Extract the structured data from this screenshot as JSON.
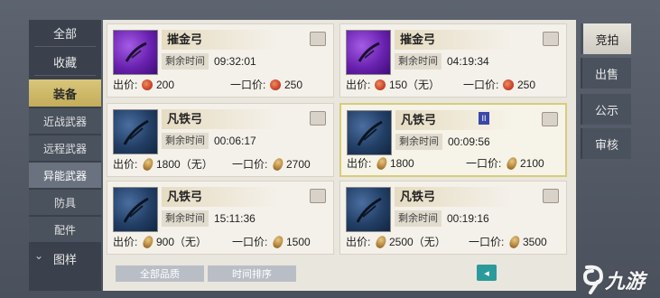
{
  "sidebar": {
    "items": [
      {
        "label": "全部"
      },
      {
        "label": "收藏"
      },
      {
        "label": "装备",
        "active": true
      },
      {
        "label": "近战武器"
      },
      {
        "label": "远程武器"
      },
      {
        "label": "异能武器",
        "selected": true
      },
      {
        "label": "防具"
      },
      {
        "label": "配件"
      },
      {
        "label": "图样"
      }
    ],
    "collapse_glyph": "⌄"
  },
  "listings": [
    {
      "name": "摧金弓",
      "time_label": "剩余时间",
      "time": "09:32:01",
      "bid_label": "出价:",
      "bid": "200",
      "buyout_label": "一口价:",
      "buyout": "250",
      "currency": "red-coin",
      "thumb": "purple"
    },
    {
      "name": "摧金弓",
      "time_label": "剩余时间",
      "time": "04:19:34",
      "bid_label": "出价:",
      "bid": "150（无）",
      "buyout_label": "一口价:",
      "buyout": "250",
      "currency": "red-coin",
      "thumb": "purple"
    },
    {
      "name": "凡铁弓",
      "time_label": "剩余时间",
      "time": "00:06:17",
      "bid_label": "出价:",
      "bid": "1800（无）",
      "buyout_label": "一口价:",
      "buyout": "2700",
      "currency": "gold-coin",
      "thumb": "blue"
    },
    {
      "name": "凡铁弓",
      "time_label": "剩余时间",
      "time": "00:09:56",
      "bid_label": "出价:",
      "bid": "1800",
      "buyout_label": "一口价:",
      "buyout": "2100",
      "currency": "gold-coin",
      "thumb": "blue",
      "badge": "II",
      "selected": true
    },
    {
      "name": "凡铁弓",
      "time_label": "剩余时间",
      "time": "15:11:36",
      "bid_label": "出价:",
      "bid": "900（无）",
      "buyout_label": "一口价:",
      "buyout": "1500",
      "currency": "gold-coin",
      "thumb": "blue"
    },
    {
      "name": "凡铁弓",
      "time_label": "剩余时间",
      "time": "00:19:16",
      "bid_label": "出价:",
      "bid": "2500（无）",
      "buyout_label": "一口价:",
      "buyout": "3500",
      "currency": "gold-coin",
      "thumb": "blue"
    }
  ],
  "filters": {
    "quality": "全部品质",
    "sort": "时间排序",
    "back_glyph": "◂"
  },
  "tabs": [
    {
      "label": "竞拍",
      "active": true
    },
    {
      "label": "出售"
    },
    {
      "label": "公示"
    },
    {
      "label": "审核"
    }
  ],
  "watermark": {
    "text": "九游"
  },
  "colors": {
    "accent_gold": "#d9c67a",
    "panel_bg": "#e9e6de",
    "sidebar_bg": "#3a414c",
    "selected_border": "#d8cc7a"
  }
}
